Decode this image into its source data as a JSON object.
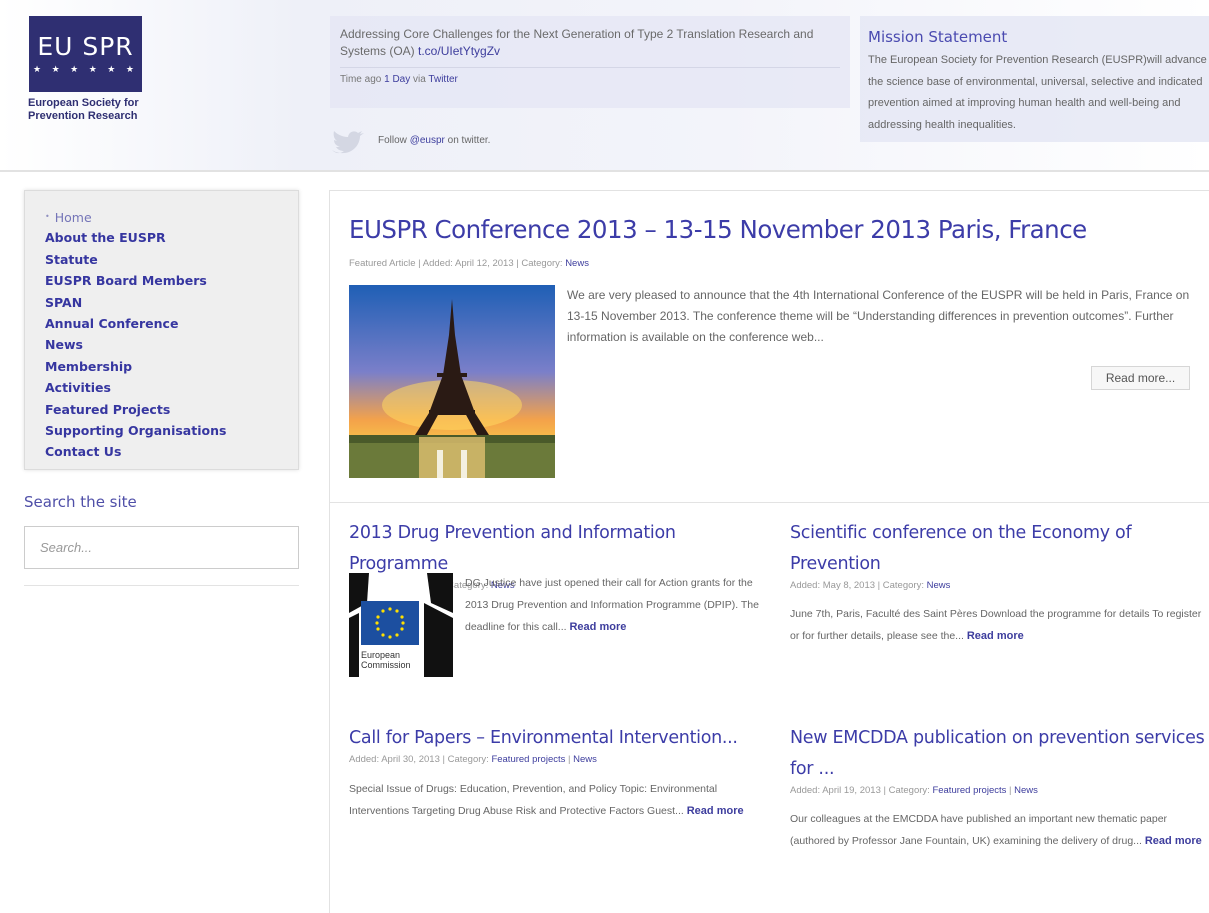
{
  "header": {
    "logo": {
      "line1": "EU SPR",
      "caption_line1": "European Society for",
      "caption_line2": "Prevention Research"
    },
    "tweet": {
      "text": "Addressing Core Challenges for the Next Generation of Type 2 Translation Research and Systems (OA)",
      "link": "t.co/UIetYtygZv",
      "time_prefix": "Time ago",
      "time_link": "1 Day",
      "via_text": "via",
      "via_link": "Twitter"
    },
    "follow": {
      "prefix": "Follow",
      "handle": "@euspr",
      "suffix": "on twitter."
    },
    "mission": {
      "title": "Mission Statement",
      "text": "The European Society for Prevention Research (EUSPR)will advance the science base of environmental, universal, selective and indicated prevention aimed at improving human health and well-being and addressing health inequalities."
    }
  },
  "sidebar": {
    "nav": [
      "Home",
      "About the EUSPR",
      "Statute",
      "EUSPR Board Members",
      "SPAN",
      "Annual Conference",
      "News",
      "Membership",
      "Activities",
      "Featured Projects",
      "Supporting Organisations",
      "Contact Us"
    ],
    "search_label": "Search the site",
    "search_placeholder": "Search..."
  },
  "featured": {
    "title": "EUSPR Conference 2013 – 13-15 November 2013 Paris, France",
    "meta_prefix": "Featured Article | Added: April 12, 2013 | Category:",
    "category": "News",
    "excerpt": "We are very pleased to announce that the 4th International Conference of the EUSPR will be held in Paris, France on 13-15 November 2013. The conference theme will be “Understanding differences in prevention outcomes”. Further information is available on the conference web...",
    "read_more": "Read more..."
  },
  "posts": [
    {
      "title": "2013 Drug Prevention and Information Programme",
      "meta_prefix": "Added: May 13, 2013 | Category:",
      "categories": [
        "News"
      ],
      "excerpt": "DG Justice have just opened their call for Action grants for the 2013 Drug Prevention and Information Programme (DPIP). The deadline for this call...",
      "read_more": "Read more",
      "image_caption_1": "European",
      "image_caption_2": "Commission"
    },
    {
      "title": "Scientific conference on the Economy of Prevention",
      "meta_prefix": "Added: May 8, 2013 | Category:",
      "categories": [
        "News"
      ],
      "excerpt": "June 7th, Paris, Faculté des Saint Pères Download the programme for details    To register or for further details, please see the...",
      "read_more": "Read more"
    },
    {
      "title": "Call for Papers – Environmental Intervention...",
      "meta_prefix": "Added: April 30, 2013 | Category:",
      "categories": [
        "Featured projects",
        "News"
      ],
      "excerpt": "Special Issue of Drugs: Education, Prevention, and Policy Topic: Environmental Interventions Targeting Drug Abuse Risk and Protective Factors Guest...",
      "read_more": "Read more"
    },
    {
      "title": "New EMCDDA publication on prevention services for ...",
      "meta_prefix": "Added: April 19, 2013 | Category:",
      "categories": [
        "Featured projects",
        "News"
      ],
      "excerpt": "Our colleagues at the EMCDDA have published an important new thematic paper (authored by Professor Jane Fountain, UK) examining the delivery of drug...",
      "read_more": "Read more"
    }
  ],
  "colors": {
    "brand": "#2f2f72",
    "link": "#3c3ca8",
    "nav": "#3636a0"
  },
  "icons": [
    "twitter-bird-icon",
    "eiffel-tower-image",
    "eu-flag-image"
  ]
}
